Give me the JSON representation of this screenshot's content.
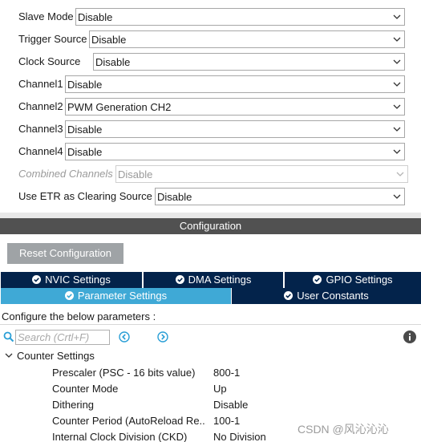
{
  "mode": {
    "fields": [
      {
        "label": "Slave Mode",
        "value": "Disable",
        "enabled": true
      },
      {
        "label": "Trigger Source",
        "value": "Disable",
        "enabled": true
      },
      {
        "label": "Clock Source",
        "value": "Disable",
        "enabled": true
      },
      {
        "label": "Channel1",
        "value": "Disable",
        "enabled": true
      },
      {
        "label": "Channel2",
        "value": "PWM Generation CH2",
        "enabled": true
      },
      {
        "label": "Channel3",
        "value": "Disable",
        "enabled": true
      },
      {
        "label": "Channel4",
        "value": "Disable",
        "enabled": true
      },
      {
        "label": "Combined Channels",
        "value": "Disable",
        "enabled": false
      },
      {
        "label": "Use ETR as Clearing Source",
        "value": "Disable",
        "enabled": true
      }
    ]
  },
  "configuration": {
    "header": "Configuration",
    "reset_label": "Reset Configuration",
    "tabs_row1": [
      "NVIC Settings",
      "DMA Settings",
      "GPIO Settings"
    ],
    "tabs_row2": [
      "Parameter Settings",
      "User Constants"
    ],
    "hint": "Configure the below parameters :",
    "search_placeholder": "Search (Crtl+F)",
    "section_title": "Counter Settings",
    "params": [
      {
        "name": "Prescaler (PSC - 16 bits value)",
        "value": "800-1"
      },
      {
        "name": "Counter Mode",
        "value": "Up"
      },
      {
        "name": "Dithering",
        "value": "Disable"
      },
      {
        "name": "Counter Period (AutoReload Re...",
        "value": "100-1"
      },
      {
        "name": "Internal Clock Division (CKD)",
        "value": "No Division"
      }
    ]
  },
  "watermark": "CSDN @风沁沁沁",
  "colors": {
    "header_bg": "#515151",
    "tab_dark": "#03234b",
    "tab_active": "#3fa9d6",
    "reset_button": "#9fa3a6",
    "nav_icon": "#2a9fd6"
  }
}
